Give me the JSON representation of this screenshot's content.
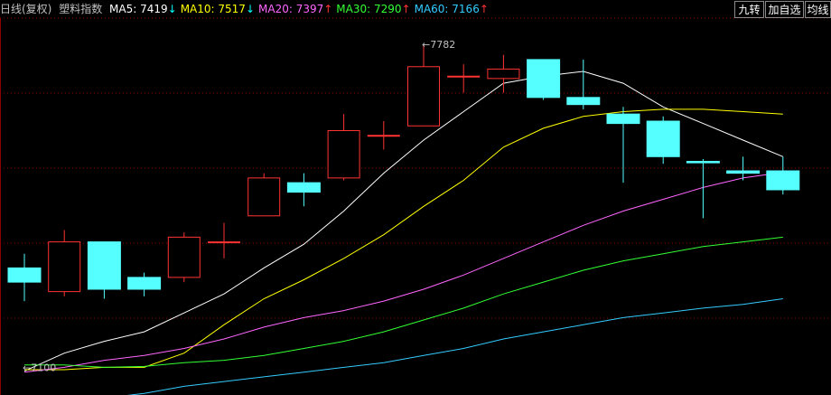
{
  "header": {
    "period": "日线(复权)",
    "name": "塑料指数",
    "ma": [
      {
        "label": "MA5: 7419",
        "arrow": "↓",
        "color": "#ffffff",
        "arrow_color": "#00ffff"
      },
      {
        "label": "MA10: 7517",
        "arrow": "↓",
        "color": "#ffff00",
        "arrow_color": "#00ffff"
      },
      {
        "label": "MA20: 7397",
        "arrow": "↑",
        "color": "#ff66ff",
        "arrow_color": "#ff3333"
      },
      {
        "label": "MA30: 7290",
        "arrow": "↑",
        "color": "#33ff33",
        "arrow_color": "#ff3333"
      },
      {
        "label": "MA60: 7166",
        "arrow": "↑",
        "color": "#33ccff",
        "arrow_color": "#ff3333"
      }
    ]
  },
  "buttons": [
    "九转",
    "加自选",
    "均线"
  ],
  "colors": {
    "up": "#ff3333",
    "down": "#55ffff",
    "grid": "#8b0000",
    "text_dim": "#c0c0c0"
  },
  "chart_data": {
    "type": "candlestick",
    "ylim": [
      7055,
      7830
    ],
    "annotations": [
      {
        "text": "7782",
        "index": 10,
        "value": 7782
      },
      {
        "text": "7100",
        "index": 0,
        "value": 7100
      }
    ],
    "candles": [
      {
        "open": 7310,
        "close": 7280,
        "high": 7340,
        "low": 7240
      },
      {
        "open": 7260,
        "close": 7365,
        "high": 7390,
        "low": 7250
      },
      {
        "open": 7365,
        "close": 7265,
        "high": 7365,
        "low": 7245
      },
      {
        "open": 7290,
        "close": 7265,
        "high": 7300,
        "low": 7250
      },
      {
        "open": 7290,
        "close": 7375,
        "high": 7385,
        "low": 7280
      },
      {
        "open": 7365,
        "close": 7365,
        "high": 7405,
        "low": 7330
      },
      {
        "open": 7420,
        "close": 7500,
        "high": 7510,
        "low": 7420
      },
      {
        "open": 7490,
        "close": 7470,
        "high": 7510,
        "low": 7440
      },
      {
        "open": 7500,
        "close": 7600,
        "high": 7635,
        "low": 7495
      },
      {
        "open": 7590,
        "close": 7590,
        "high": 7620,
        "low": 7560
      },
      {
        "open": 7610,
        "close": 7735,
        "high": 7782,
        "low": 7610
      },
      {
        "open": 7715,
        "close": 7715,
        "high": 7740,
        "low": 7680
      },
      {
        "open": 7710,
        "close": 7730,
        "high": 7760,
        "low": 7680
      },
      {
        "open": 7750,
        "close": 7670,
        "high": 7750,
        "low": 7665
      },
      {
        "open": 7670,
        "close": 7655,
        "high": 7750,
        "low": 7645
      },
      {
        "open": 7635,
        "close": 7615,
        "high": 7650,
        "low": 7490
      },
      {
        "open": 7620,
        "close": 7545,
        "high": 7630,
        "low": 7530
      },
      {
        "open": 7535,
        "close": 7532,
        "high": 7540,
        "low": 7415
      },
      {
        "open": 7515,
        "close": 7510,
        "high": 7545,
        "low": 7495
      },
      {
        "open": 7515,
        "close": 7475,
        "high": 7545,
        "low": 7465
      }
    ],
    "series": [
      {
        "name": "MA5",
        "color": "#ffffff",
        "values": [
          7092,
          7130,
          7155,
          7175,
          7215,
          7255,
          7310,
          7360,
          7430,
          7510,
          7580,
          7640,
          7700,
          7715,
          7725,
          7700,
          7650,
          7615,
          7580,
          7545
        ]
      },
      {
        "name": "MA10",
        "color": "#ffff00",
        "values": [
          7095,
          7095,
          7100,
          7100,
          7130,
          7190,
          7245,
          7285,
          7330,
          7380,
          7440,
          7495,
          7565,
          7605,
          7630,
          7640,
          7645,
          7645,
          7640,
          7635
        ]
      },
      {
        "name": "MA20",
        "color": "#ff66ff",
        "values": [
          7090,
          7100,
          7115,
          7125,
          7140,
          7160,
          7185,
          7205,
          7220,
          7240,
          7265,
          7295,
          7330,
          7365,
          7400,
          7430,
          7455,
          7480,
          7500,
          7512
        ]
      },
      {
        "name": "MA30",
        "color": "#33ff33",
        "values": [
          7105,
          7105,
          7100,
          7102,
          7110,
          7115,
          7125,
          7140,
          7155,
          7175,
          7200,
          7225,
          7255,
          7280,
          7305,
          7325,
          7340,
          7355,
          7365,
          7375
        ]
      },
      {
        "name": "MA60",
        "color": "#33ccff",
        "values": [
          7015,
          7025,
          7035,
          7045,
          7060,
          7070,
          7080,
          7090,
          7100,
          7110,
          7125,
          7140,
          7160,
          7175,
          7190,
          7205,
          7215,
          7225,
          7233,
          7245
        ]
      }
    ]
  }
}
